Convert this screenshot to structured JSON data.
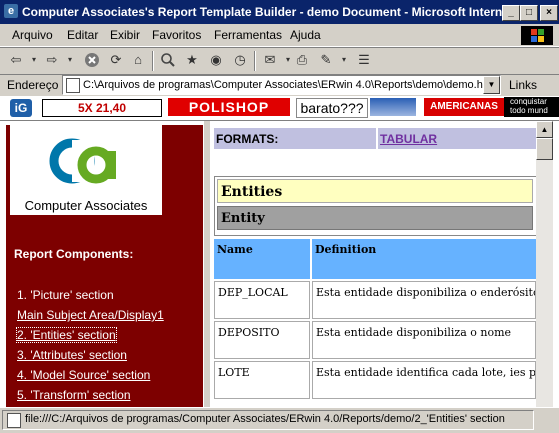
{
  "window": {
    "title": "Computer Associates's Report Template Builder - demo Document - Microsoft Interne",
    "buttons": {
      "minimize": "_",
      "restore": "□",
      "close": "×"
    }
  },
  "menu": [
    "Arquivo",
    "Editar",
    "Exibir",
    "Favoritos",
    "Ferramentas",
    "Ajuda"
  ],
  "address": {
    "label": "Endereço",
    "url": "C:\\Arquivos de programas\\Computer Associates\\ERwin 4.0\\Reports\\demo\\demo.htm",
    "links": "Links"
  },
  "ads": {
    "ig": "iG",
    "ad1": "5X 21,40",
    "ad2": "POLISHOP",
    "ad3": "barato???",
    "ad4": "AMERICANAS",
    "ad5_line1": "conquistar",
    "ad5_line2": "todo mund"
  },
  "nav": {
    "logo_text": "Computer Associates",
    "title": "Report Components:",
    "items": [
      "1. 'Picture' section",
      "Main Subject Area/Display1",
      "2. 'Entities' section",
      "3. 'Attributes' section",
      "4. 'Model Source' section",
      "5. 'Transform' section"
    ]
  },
  "report": {
    "formats_label": "FORMATS:",
    "formats_link": "TABULAR",
    "entities_header": "Entities",
    "entity_label": "Entity",
    "columns": [
      "Name",
      "Definition"
    ],
    "rows": [
      [
        "DEP_LOCAL",
        "Esta entidade disponibiliza o enderósito"
      ],
      [
        "DEPOSITO",
        "Esta entidade disponibiliza o nome"
      ],
      [
        "LOTE",
        "Esta entidade identifica cada lote, ies pert"
      ]
    ]
  },
  "status": {
    "text": "file:///C:/Arquivos de programas/Computer Associates/ERwin 4.0/Reports/demo/2_'Entities' section"
  },
  "colors": {
    "titlebar": "#0a246a",
    "nav_bg": "#7d0000",
    "formats_bg": "#c0c0e0",
    "entities_header_bg": "#ffffc0",
    "table_header_bg": "#66b2ff"
  }
}
